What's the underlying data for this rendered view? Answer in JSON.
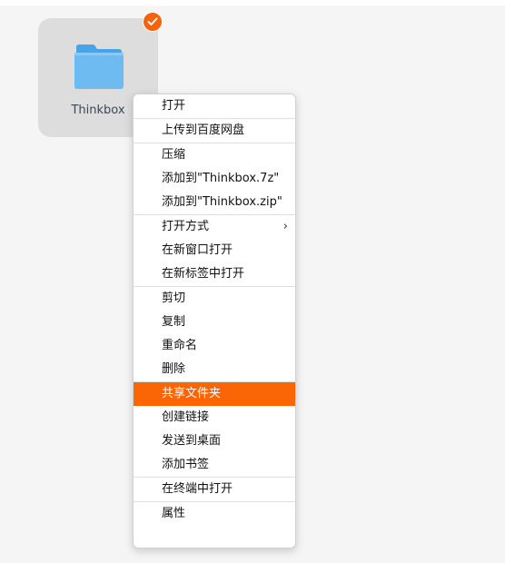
{
  "desktop": {
    "file": {
      "name": "Thinkbox",
      "icon": "folder-icon",
      "selected": true
    }
  },
  "context_menu": {
    "highlight_color": "#fb6506",
    "groups": [
      [
        {
          "label": "打开"
        }
      ],
      [
        {
          "label": "上传到百度网盘"
        }
      ],
      [
        {
          "label": "压缩"
        },
        {
          "label": "添加到\"Thinkbox.7z\""
        },
        {
          "label": "添加到\"Thinkbox.zip\""
        }
      ],
      [
        {
          "label": "打开方式",
          "submenu_glyph": "›"
        },
        {
          "label": "在新窗口打开"
        },
        {
          "label": "在新标签中打开"
        }
      ],
      [
        {
          "label": "剪切"
        },
        {
          "label": "复制"
        },
        {
          "label": "重命名"
        },
        {
          "label": "删除"
        }
      ],
      [
        {
          "label": "共享文件夹",
          "highlighted": true
        },
        {
          "label": "创建链接"
        },
        {
          "label": "发送到桌面"
        },
        {
          "label": "添加书签"
        }
      ],
      [
        {
          "label": "在终端中打开"
        }
      ],
      [
        {
          "label": "属性"
        }
      ]
    ]
  }
}
